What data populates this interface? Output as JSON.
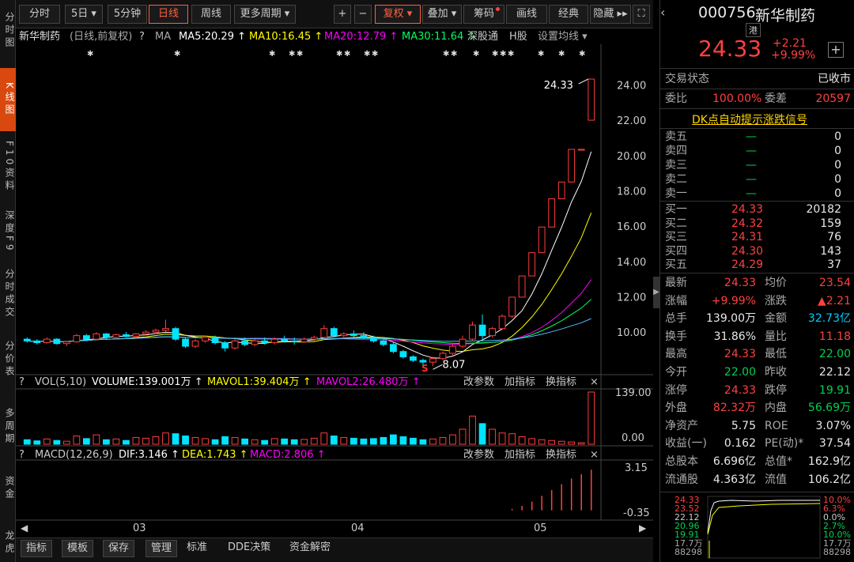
{
  "side_tabs": [
    {
      "label": "分时图"
    },
    {
      "label": "K线图"
    },
    {
      "label": "F10资料"
    },
    {
      "label": "深度F9"
    },
    {
      "label": "分时成交"
    },
    {
      "label": "分价表"
    },
    {
      "label": "多周期"
    },
    {
      "label": "资金"
    },
    {
      "label": "龙虎"
    }
  ],
  "toolbar": {
    "items": [
      "分时",
      "5日 ▾",
      "5分钟",
      "日线",
      "周线",
      "更多周期 ▾",
      "+",
      "−",
      "复权 ▾",
      "叠加 ▾",
      "筹码",
      "画线",
      "经典",
      "隐藏 ▸▸",
      "⛶"
    ]
  },
  "legend": {
    "name": "新华制药",
    "mode": "(日线,前复权)",
    "q": "?",
    "ma": "MA",
    "ma5": "MA5:20.29 ↑",
    "ma10": "MA10:16.45 ↑",
    "ma20": "MA20:12.79 ↑",
    "ma30": "MA30:11.64 ↑",
    "sg": "深股通",
    "hk": "H股",
    "set": "设置均线 ▾"
  },
  "price_axis": [
    "24.00",
    "22.00",
    "20.00",
    "18.00",
    "16.00",
    "14.00",
    "12.00",
    "10.00"
  ],
  "annot": {
    "high": "24.33",
    "low": "8.07",
    "s": "S"
  },
  "vol": {
    "q": "?",
    "title": "VOL(5,10)",
    "volume": "VOLUME:139.001万 ↑",
    "m1": "MAVOL1:39.404万 ↑",
    "m2": "MAVOL2:26.480万 ↑",
    "a1": "改参数",
    "a2": "加指标",
    "a3": "换指标",
    "x": "×",
    "ax_top": "139.00",
    "ax_bot": "0.00"
  },
  "macd": {
    "q": "?",
    "title": "MACD(12,26,9)",
    "dif": "DIF:3.146 ↑",
    "dea": "DEA:1.743 ↑",
    "macd": "MACD:2.806 ↑",
    "a1": "改参数",
    "a2": "加指标",
    "a3": "换指标",
    "x": "×",
    "ax_top": "3.15",
    "ax_bot": "-0.35"
  },
  "date_axis": [
    "03",
    "04",
    "05"
  ],
  "bottom": [
    "指标",
    "模板",
    "保存",
    "管理",
    "标准",
    "DDE决策",
    "资金解密"
  ],
  "colors": {
    "up": "#ff3c3c",
    "down": "#00e4ff",
    "ma5": "#ffffff",
    "ma10": "#ffff00",
    "ma20": "#ff00ff",
    "ma30": "#00ff60",
    "ma60": "#4fc1ff",
    "bg": "#000000"
  },
  "quote": {
    "code": "000756",
    "name": "新华制药",
    "tag": "港",
    "price": "24.33",
    "chg": "+2.21",
    "pct": "+9.99%",
    "plus": "+"
  },
  "status": {
    "label": "交易状态",
    "value": "已收市"
  },
  "wb": {
    "l1": "委比",
    "v1": "100.00%",
    "l2": "委差",
    "v2": "20597"
  },
  "dk": "DK点自动提示涨跌信号",
  "sells": [
    {
      "n": "卖五",
      "p": "—",
      "v": "0"
    },
    {
      "n": "卖四",
      "p": "—",
      "v": "0"
    },
    {
      "n": "卖三",
      "p": "—",
      "v": "0"
    },
    {
      "n": "卖二",
      "p": "—",
      "v": "0"
    },
    {
      "n": "卖一",
      "p": "—",
      "v": "0"
    }
  ],
  "buys": [
    {
      "n": "买一",
      "p": "24.33",
      "v": "20182"
    },
    {
      "n": "买二",
      "p": "24.32",
      "v": "159"
    },
    {
      "n": "买三",
      "p": "24.31",
      "v": "76"
    },
    {
      "n": "买四",
      "p": "24.30",
      "v": "143"
    },
    {
      "n": "买五",
      "p": "24.29",
      "v": "37"
    }
  ],
  "stats": [
    {
      "l1": "最新",
      "v1": "24.33",
      "c1": "red",
      "l2": "均价",
      "v2": "23.54",
      "c2": "red"
    },
    {
      "l1": "涨幅",
      "v1": "+9.99%",
      "c1": "red",
      "l2": "涨跌",
      "v2": "▲2.21",
      "c2": "red"
    },
    {
      "l1": "总手",
      "v1": "139.00万",
      "c1": "white",
      "l2": "金额",
      "v2": "32.73亿",
      "c2": "cyan"
    },
    {
      "l1": "换手",
      "v1": "31.86%",
      "c1": "white",
      "l2": "量比",
      "v2": "11.18",
      "c2": "red"
    },
    {
      "l1": "最高",
      "v1": "24.33",
      "c1": "red",
      "l2": "最低",
      "v2": "22.00",
      "c2": "green"
    },
    {
      "l1": "今开",
      "v1": "22.00",
      "c1": "green",
      "l2": "昨收",
      "v2": "22.12",
      "c2": "white"
    },
    {
      "l1": "涨停",
      "v1": "24.33",
      "c1": "red",
      "l2": "跌停",
      "v2": "19.91",
      "c2": "green"
    },
    {
      "l1": "外盘",
      "v1": "82.32万",
      "c1": "red",
      "l2": "内盘",
      "v2": "56.69万",
      "c2": "green"
    },
    {
      "l1": "净资产",
      "v1": "5.75",
      "c1": "white",
      "l2": "ROE",
      "v2": "3.07%",
      "c2": "white"
    },
    {
      "l1": "收益(一)",
      "v1": "0.162",
      "c1": "white",
      "l2": "PE(动)*",
      "v2": "37.54",
      "c2": "white"
    },
    {
      "l1": "总股本",
      "v1": "6.696亿",
      "c1": "white",
      "l2": "总值*",
      "v2": "162.9亿",
      "c2": "white"
    },
    {
      "l1": "流通股",
      "v1": "4.363亿",
      "c1": "white",
      "l2": "流值",
      "v2": "106.2亿",
      "c2": "white"
    }
  ],
  "mini": {
    "left": [
      "24.33",
      "23.52",
      "22.12",
      "20.96",
      "19.91",
      "17.7万",
      "88298"
    ],
    "right": [
      "10.0%",
      "6.3%",
      "0.0%",
      "2.7%",
      "10.0%",
      "17.7万",
      "88298"
    ]
  },
  "chart_data": {
    "type": "candlestick",
    "description": "Daily K-line, price range approx 8 to 24.4",
    "xlabel": "",
    "ylabel": "",
    "ylim": [
      7.5,
      24.6
    ],
    "months": [
      "03",
      "04",
      "05"
    ],
    "candles": [
      [
        9.6,
        9.7,
        9.4,
        9.5
      ],
      [
        9.5,
        9.6,
        9.3,
        9.4
      ],
      [
        9.4,
        9.7,
        9.35,
        9.6
      ],
      [
        9.6,
        9.65,
        9.3,
        9.35
      ],
      [
        9.35,
        9.5,
        9.2,
        9.45
      ],
      [
        9.45,
        9.9,
        9.4,
        9.8
      ],
      [
        9.8,
        9.9,
        9.5,
        9.6
      ],
      [
        9.6,
        10.0,
        9.55,
        9.9
      ],
      [
        9.9,
        9.95,
        9.6,
        9.7
      ],
      [
        9.7,
        9.9,
        9.6,
        9.85
      ],
      [
        9.85,
        10.0,
        9.7,
        9.75
      ],
      [
        9.75,
        9.95,
        9.6,
        9.9
      ],
      [
        9.9,
        10.1,
        9.8,
        10.0
      ],
      [
        10.0,
        10.2,
        9.9,
        10.1
      ],
      [
        10.1,
        10.7,
        10.0,
        10.2
      ],
      [
        10.2,
        10.3,
        9.5,
        9.6
      ],
      [
        9.6,
        9.7,
        9.1,
        9.2
      ],
      [
        9.2,
        9.6,
        9.1,
        9.5
      ],
      [
        9.5,
        9.8,
        9.4,
        9.7
      ],
      [
        9.7,
        9.8,
        9.3,
        9.4
      ],
      [
        9.4,
        9.5,
        8.9,
        9.1
      ],
      [
        9.1,
        9.6,
        9.0,
        9.5
      ],
      [
        9.5,
        9.7,
        9.2,
        9.3
      ],
      [
        9.3,
        9.6,
        9.2,
        9.5
      ],
      [
        9.5,
        9.7,
        9.3,
        9.4
      ],
      [
        9.4,
        9.7,
        9.3,
        9.6
      ],
      [
        9.6,
        9.8,
        9.4,
        9.5
      ],
      [
        9.5,
        9.7,
        9.3,
        9.45
      ],
      [
        9.45,
        9.7,
        9.4,
        9.6
      ],
      [
        9.6,
        9.8,
        9.5,
        9.7
      ],
      [
        9.7,
        10.4,
        9.6,
        10.2
      ],
      [
        10.2,
        10.3,
        9.7,
        9.8
      ],
      [
        9.8,
        10.0,
        9.6,
        9.9
      ],
      [
        9.9,
        10.1,
        9.7,
        9.8
      ],
      [
        9.8,
        10.0,
        9.6,
        9.7
      ],
      [
        9.7,
        9.8,
        9.4,
        9.5
      ],
      [
        9.5,
        9.6,
        9.2,
        9.3
      ],
      [
        9.3,
        9.4,
        8.8,
        8.9
      ],
      [
        8.9,
        9.0,
        8.5,
        8.6
      ],
      [
        8.6,
        8.7,
        8.3,
        8.4
      ],
      [
        8.4,
        8.5,
        8.1,
        8.3
      ],
      [
        8.3,
        8.6,
        8.07,
        8.5
      ],
      [
        8.5,
        8.9,
        8.4,
        8.8
      ],
      [
        8.8,
        9.3,
        8.7,
        9.2
      ],
      [
        9.2,
        9.8,
        9.1,
        9.6
      ],
      [
        9.6,
        10.6,
        9.5,
        10.4
      ],
      [
        10.4,
        11.0,
        9.6,
        9.8
      ],
      [
        9.8,
        10.3,
        9.7,
        10.2
      ],
      [
        10.2,
        11.0,
        10.1,
        10.9
      ],
      [
        10.9,
        12.0,
        10.8,
        11.98
      ],
      [
        11.98,
        13.18,
        11.98,
        13.18
      ],
      [
        13.18,
        14.5,
        13.18,
        14.5
      ],
      [
        14.5,
        15.95,
        14.5,
        15.95
      ],
      [
        15.95,
        17.55,
        15.95,
        17.55
      ],
      [
        17.55,
        18.5,
        17.55,
        18.5
      ],
      [
        18.5,
        20.35,
        18.5,
        20.35
      ],
      [
        20.35,
        20.35,
        20.35,
        20.35
      ],
      [
        22.0,
        24.33,
        22.0,
        24.33
      ]
    ],
    "volume": [
      12,
      9,
      14,
      10,
      8,
      22,
      15,
      25,
      12,
      14,
      10,
      18,
      16,
      20,
      30,
      28,
      22,
      18,
      15,
      12,
      20,
      18,
      14,
      12,
      10,
      15,
      14,
      12,
      13,
      16,
      30,
      22,
      18,
      16,
      14,
      15,
      18,
      25,
      20,
      16,
      12,
      14,
      18,
      25,
      40,
      75,
      55,
      40,
      30,
      28,
      20,
      15,
      12,
      10,
      8,
      6,
      4,
      139.001
    ],
    "volume_axis": [
      0,
      139
    ],
    "macd_hist": [
      0,
      0,
      0,
      0,
      0,
      0,
      0,
      0,
      0,
      0,
      0,
      0,
      0,
      0,
      0,
      0,
      0,
      0,
      0,
      0,
      0,
      0,
      0,
      0,
      0,
      0,
      0,
      0,
      0,
      0,
      0,
      0,
      0,
      0,
      0,
      0,
      0,
      0,
      0,
      0,
      0,
      0,
      0,
      0,
      0,
      0,
      0,
      0,
      0,
      0.1,
      0.3,
      0.6,
      1.0,
      1.4,
      1.8,
      2.2,
      2.5,
      2.806
    ],
    "macd_axis": [
      -0.35,
      3.15
    ],
    "high_label": 24.33,
    "low_label": 8.07
  }
}
